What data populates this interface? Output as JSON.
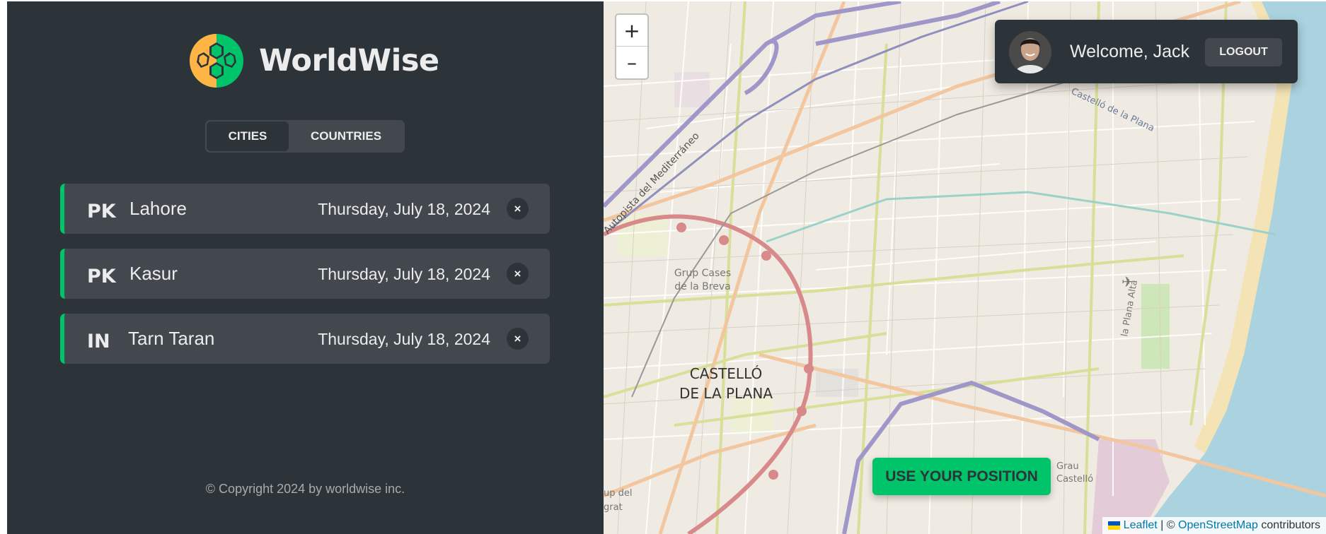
{
  "app": {
    "name": "WorldWise",
    "brand_colors": {
      "green": "#00c46a",
      "orange": "#ffb545",
      "dark": "#2d3439",
      "panel": "#42484d"
    }
  },
  "tabs": {
    "cities": "CITIES",
    "countries": "COUNTRIES",
    "active": "cities"
  },
  "cities": [
    {
      "flag": "PK",
      "name": "Lahore",
      "date": "Thursday, July 18, 2024",
      "delete": "×"
    },
    {
      "flag": "PK",
      "name": "Kasur",
      "date": "Thursday, July 18, 2024",
      "delete": "×"
    },
    {
      "flag": "IN",
      "name": "Tarn Taran",
      "date": "Thursday, July 18, 2024",
      "delete": "×"
    }
  ],
  "footer": {
    "copyright": "© Copyright 2024 by worldwise inc."
  },
  "map": {
    "zoom_in": "+",
    "zoom_out": "–",
    "labels": {
      "city_line1": "CASTELLÓ",
      "city_line2": "DE LA PLANA",
      "grup_line1": "Grup Cases",
      "grup_line2": "de la Breva",
      "autopista": "Autopista del Mediterráneo",
      "castello_road": "Castelló de la Plana",
      "plana_alta": "la Plana Alta",
      "grau_line1": "Grau",
      "grau_line2": "Castelló",
      "edge_line1": "up del",
      "edge_line2": "grat"
    },
    "use_position": "USE YOUR POSITION",
    "attribution": {
      "leaflet": "Leaflet",
      "separator": " | © ",
      "osm": "OpenStreetMap",
      "suffix": " contributors"
    }
  },
  "user": {
    "welcome": "Welcome, Jack",
    "logout": "LOGOUT",
    "avatar_icon": "user-avatar"
  }
}
